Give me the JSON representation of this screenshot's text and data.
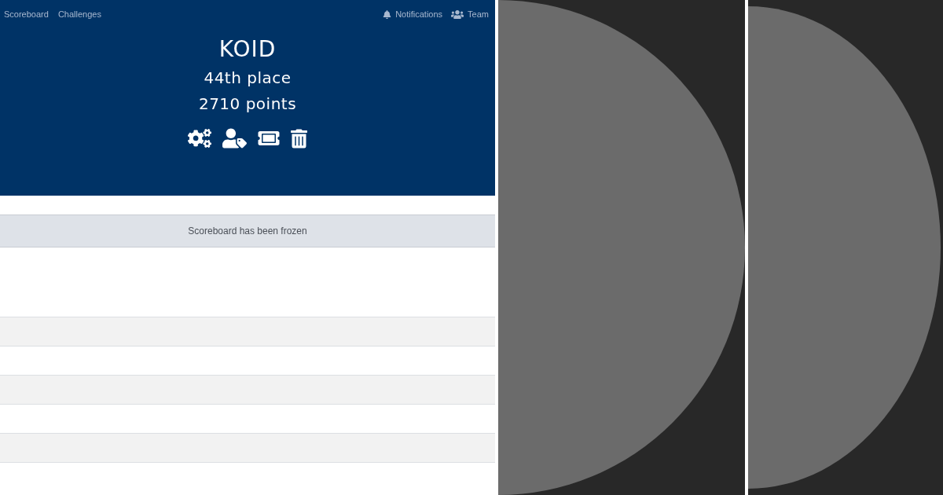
{
  "navbar": {
    "left_links": [
      {
        "label": "Scoreboard"
      },
      {
        "label": "Challenges"
      }
    ],
    "right_links": [
      {
        "label": "Notifications"
      },
      {
        "label": "Team"
      }
    ]
  },
  "team_header": {
    "name": "KOID",
    "place": "44th place",
    "points": "2710 points"
  },
  "notice": {
    "message": "Scoreboard has been frozen"
  }
}
